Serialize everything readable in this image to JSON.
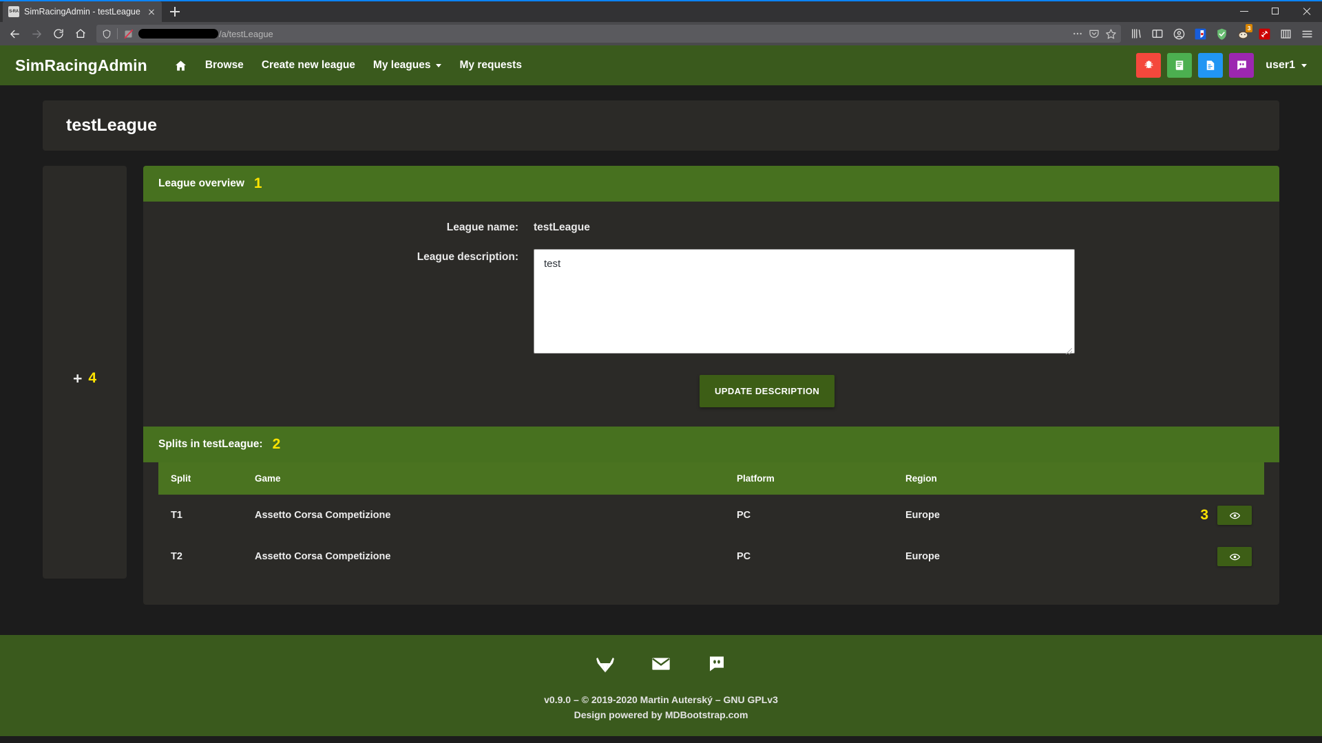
{
  "browser": {
    "tab": {
      "title": "SimRacingAdmin - testLeague",
      "favicon_label": "S-RA"
    },
    "new_tab_label": "+",
    "url": {
      "redacted": true,
      "path": "/a/testLeague"
    },
    "toolbar_icons": [
      "back-icon",
      "forward-icon",
      "reload-icon",
      "home-icon",
      "shield-icon",
      "no-script-icon",
      "page-actions-icon",
      "pocket-icon",
      "bookmark-star-icon",
      "library-icon",
      "sidebar-icon",
      "account-icon",
      "bitwarden-extension-icon",
      "adguard-extension-icon",
      "honey-extension-icon",
      "wappalyzer-extension-icon",
      "grid-extension-icon",
      "app-menu-icon"
    ],
    "extension_badge": "3",
    "window_controls": [
      "minimize",
      "restore",
      "close"
    ]
  },
  "navbar": {
    "brand": "SimRacingAdmin",
    "links": [
      {
        "label": "",
        "icon": "home-icon",
        "has_caret": false
      },
      {
        "label": "Browse",
        "icon": "",
        "has_caret": false
      },
      {
        "label": "Create new league",
        "icon": "",
        "has_caret": false
      },
      {
        "label": "My leagues",
        "icon": "",
        "has_caret": true
      },
      {
        "label": "My requests",
        "icon": "",
        "has_caret": false
      }
    ],
    "action_buttons": [
      {
        "name": "report-bug-button",
        "icon": "bug-icon",
        "color": "#f4483c"
      },
      {
        "name": "documentation-button",
        "icon": "book-icon",
        "color": "#4caf50"
      },
      {
        "name": "changelog-button",
        "icon": "file-text-icon",
        "color": "#2196f3"
      },
      {
        "name": "discord-button",
        "icon": "discord-icon",
        "color": "#9c27b0"
      }
    ],
    "user": "user1"
  },
  "page": {
    "title": "testLeague",
    "side_panel": {
      "plus_label": "+",
      "annotation": "4"
    }
  },
  "overview": {
    "header": "League overview",
    "annotation": "1",
    "name_label": "League name:",
    "name_value": "testLeague",
    "description_label": "League description:",
    "description_value": "test",
    "description_placeholder": "",
    "update_button": "UPDATE DESCRIPTION"
  },
  "splits": {
    "header": "Splits in testLeague:",
    "annotation": "2",
    "row_annotation": "3",
    "columns": [
      "Split",
      "Game",
      "Platform",
      "Region",
      ""
    ],
    "rows": [
      {
        "split": "T1",
        "game": "Assetto Corsa Competizione",
        "platform": "PC",
        "region": "Europe",
        "action_icon": "eye-icon"
      },
      {
        "split": "T2",
        "game": "Assetto Corsa Competizione",
        "platform": "PC",
        "region": "Europe",
        "action_icon": "eye-icon"
      }
    ]
  },
  "footer": {
    "icons": [
      {
        "name": "gitlab-icon"
      },
      {
        "name": "email-icon"
      },
      {
        "name": "discord-icon"
      }
    ],
    "line1": "v0.9.0 – © 2019-2020 Martin Auterský – GNU GPLv3",
    "line2_prefix": "Design powered by ",
    "line2_link": "MDBootstrap.com"
  },
  "colors": {
    "navbar_green": "#3a5a1d",
    "card_header_green": "#47711f",
    "table_header_green": "#4a7320",
    "button_green": "#3d5e16",
    "annotation_yellow": "#ffe400",
    "card_bg": "#2b2a27",
    "page_bg": "#1c1c1c"
  }
}
